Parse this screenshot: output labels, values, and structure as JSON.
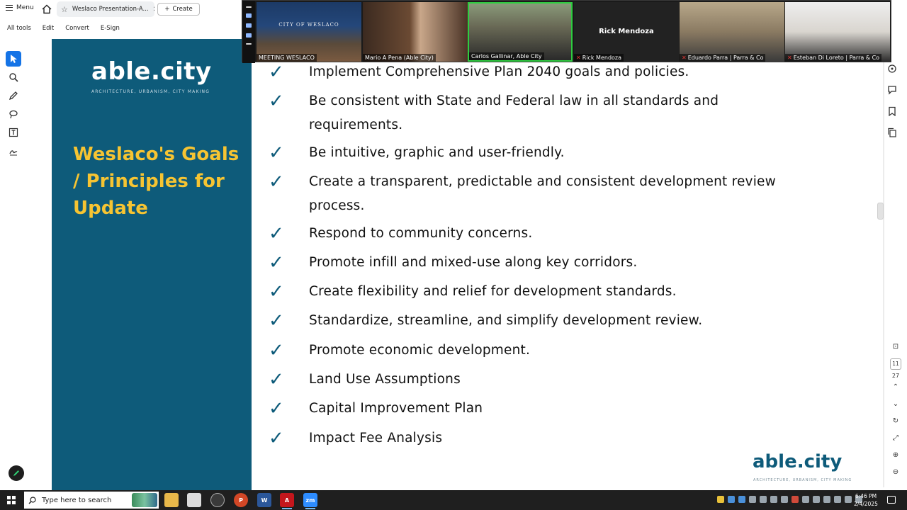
{
  "app": {
    "menu_label": "Menu",
    "tab_title": "Weslaco Presentation-A...",
    "create_label": "Create",
    "toolbar_items": [
      "All tools",
      "Edit",
      "Convert",
      "E-Sign"
    ]
  },
  "slide": {
    "logo_text": "able.city",
    "logo_tagline": "ARCHITECTURE, URBANISM, CITY MAKING",
    "heading": "Weslaco's Goals / Principles for Update",
    "check_glyph": "✓",
    "bullets": [
      "Implement Comprehensive Plan 2040 goals and policies.",
      "Be consistent with State and Federal law in all standards and requirements.",
      "Be intuitive, graphic and user-friendly.",
      "Create a transparent, predictable and consistent development review process.",
      "Respond to community concerns.",
      "Promote infill and mixed-use along key corridors.",
      "Create flexibility and relief for development standards.",
      "Standardize, streamline, and simplify development review.",
      "Promote economic development.",
      "Land Use Assumptions",
      "Capital Improvement Plan",
      "Impact Fee Analysis"
    ],
    "colors": {
      "panel": "#0e5b7a",
      "heading": "#f6c432",
      "check": "#0e5b7a"
    }
  },
  "zoom": {
    "participants": [
      {
        "name": "MEETING WESLACO",
        "muted": false,
        "sign": "CITY OF WESLACO"
      },
      {
        "name": "Mario A Pena (Able City)",
        "muted": false
      },
      {
        "name": "Carlos Gallinar, Able City",
        "muted": false,
        "speaking": true
      },
      {
        "name": "Rick Mendoza",
        "muted": true,
        "center_label": "Rick Mendoza"
      },
      {
        "name": "Eduardo Parra | Parra & Co",
        "muted": true
      },
      {
        "name": "Esteban Di Loreto | Parra & Co",
        "muted": true
      }
    ]
  },
  "page_nav": {
    "current_page": "11",
    "total_pages": "27"
  },
  "taskbar": {
    "search_placeholder": "Type here to search",
    "time": "6:46 PM",
    "date": "2/4/2025",
    "apps": [
      "zm"
    ]
  }
}
